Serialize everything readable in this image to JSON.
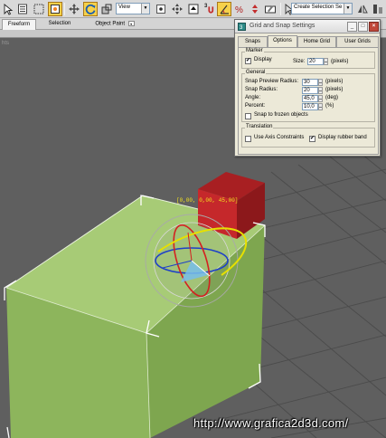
{
  "toolbar": {
    "view_select": "View",
    "selection_set_placeholder": "Create Selection Se",
    "snap_number": "3",
    "colors": {
      "active_button": "#f6d14a",
      "toolbar_bg": "#d9d9d9"
    }
  },
  "ribbon": {
    "tabs": [
      {
        "label": "Freeform",
        "active": true
      },
      {
        "label": "Selection",
        "active": false
      },
      {
        "label": "Object Paint",
        "active": false
      }
    ]
  },
  "viewport": {
    "corner_label": "hts",
    "transform_readout": "[0,00, 0,00, 45,00]",
    "watermark": "http://www.grafica2d3d.com/",
    "colors": {
      "background": "#5f5f5f",
      "green_box": "#9cc46a",
      "red_cube": "#b8262a",
      "grid": "#4d4d4d"
    }
  },
  "dialog": {
    "title": "Grid and Snap Settings",
    "tabs": [
      {
        "label": "Snaps",
        "active": false
      },
      {
        "label": "Options",
        "active": true
      },
      {
        "label": "Home Grid",
        "active": false
      },
      {
        "label": "User Grids",
        "active": false
      }
    ],
    "marker": {
      "title": "Marker",
      "display_label": "Display",
      "display_checked": true,
      "size_label": "Size:",
      "size_value": "20",
      "size_unit": "(pixels)"
    },
    "general": {
      "title": "General",
      "snap_preview_radius_label": "Snap Preview Radius:",
      "snap_preview_radius_value": "30",
      "snap_preview_radius_unit": "(pixels)",
      "snap_radius_label": "Snap Radius:",
      "snap_radius_value": "20",
      "snap_radius_unit": "(pixels)",
      "angle_label": "Angle:",
      "angle_value": "45,0",
      "angle_unit": "(deg)",
      "percent_label": "Percent:",
      "percent_value": "10,0",
      "percent_unit": "(%)",
      "snap_frozen_label": "Snap to frozen objects",
      "snap_frozen_checked": false
    },
    "translation": {
      "title": "Translation",
      "axis_constraints_label": "Use Axis Constraints",
      "axis_constraints_checked": false,
      "rubber_band_label": "Display rubber band",
      "rubber_band_checked": true
    }
  }
}
